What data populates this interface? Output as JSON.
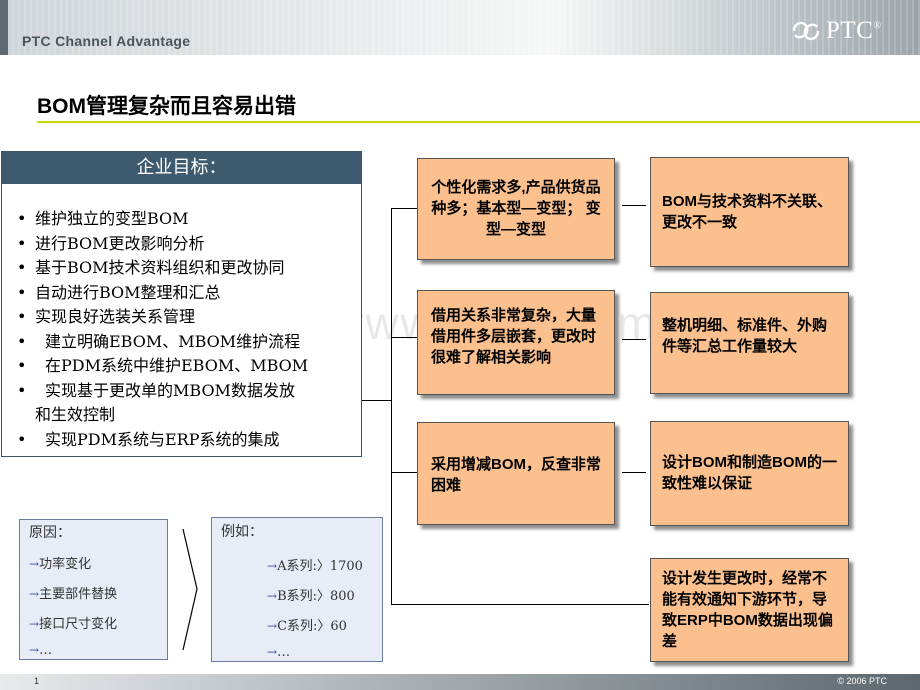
{
  "header": {
    "subtitle": "PTC Channel Advantage",
    "logo_text": "PTC",
    "logo_mark": "®"
  },
  "title": "BOM管理复杂而且容易出错",
  "goals": {
    "heading": "企业目标：",
    "items": [
      "维护独立的变型BOM",
      "进行BOM更改影响分析",
      "基于BOM技术资料组织和更改协同",
      "自动进行BOM整理和汇总",
      "实现良好选装关系管理",
      "建立明确EBOM、MBOM维护流程",
      "在PDM系统中维护EBOM、MBOM",
      "实现基于更改单的MBOM数据发放",
      "和生效控制",
      "实现PDM系统与ERP系统的集成"
    ]
  },
  "causes": [
    "个性化需求多,产品供货品种多；基本型—变型； 变型—变型",
    "借用关系非常复杂，大量借用件多层嵌套，更改时很难了解相关影响",
    "采用增减BOM，反查非常困难"
  ],
  "effects": [
    "BOM与技术资料不关联、更改不一致",
    "整机明细、标准件、外购件等汇总工作量较大",
    "设计BOM和制造BOM的一致性难以保证",
    "设计发生更改时，经常不能有效通知下游环节，导致ERP中BOM数据出现偏差"
  ],
  "reasons_box": {
    "title": "原因：",
    "items": [
      "功率变化",
      "主要部件替换",
      "接口尺寸变化",
      "…"
    ]
  },
  "examples_box": {
    "title": "例如：",
    "items": [
      "A系列:〉1700",
      "B系列:〉800",
      "C系列:〉60",
      "…"
    ]
  },
  "arrow_glyph": "→",
  "watermark": "www.zixin.com.cn",
  "footer": {
    "page": "1",
    "copyright": "© 2006 PTC"
  },
  "colors": {
    "accent_rule": "#c9d800",
    "goal_header": "#3e5a6e",
    "box_fill": "#fbc08d",
    "small_box_fill": "#e7ecf7"
  }
}
